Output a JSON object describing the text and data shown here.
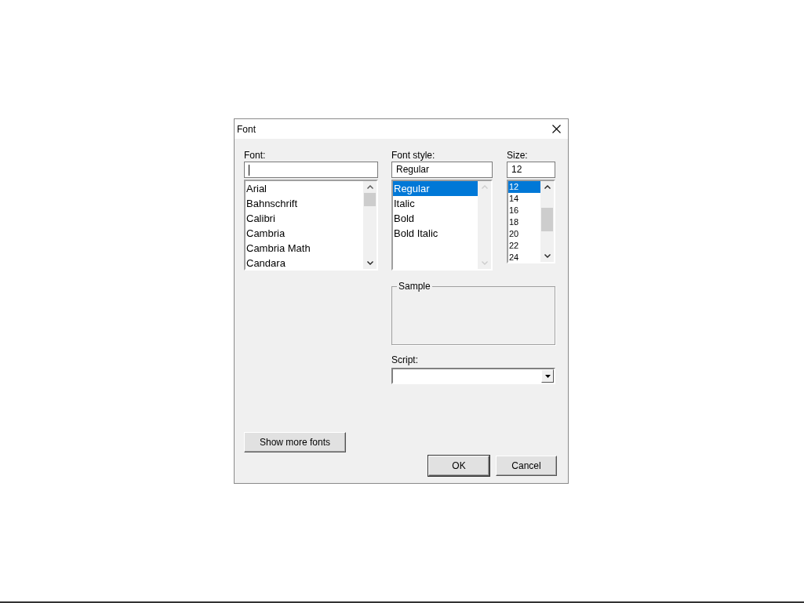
{
  "window": {
    "title": "Font"
  },
  "font": {
    "label": "Font:",
    "items": [
      {
        "label": "Arial",
        "selected": false
      },
      {
        "label": "Bahnschrift",
        "selected": false
      },
      {
        "label": "Calibri",
        "selected": false
      },
      {
        "label": "Cambria",
        "selected": false
      },
      {
        "label": "Cambria Math",
        "selected": false
      },
      {
        "label": "Candara",
        "selected": false
      }
    ]
  },
  "font_style": {
    "label": "Font style:",
    "value": "Regular",
    "items": [
      {
        "label": "Regular",
        "selected": true
      },
      {
        "label": "Italic",
        "selected": false
      },
      {
        "label": "Bold",
        "selected": false
      },
      {
        "label": "Bold Italic",
        "selected": false
      }
    ]
  },
  "size": {
    "label": "Size:",
    "value": "12",
    "items": [
      {
        "label": "12",
        "selected": true
      },
      {
        "label": "14",
        "selected": false
      },
      {
        "label": "16",
        "selected": false
      },
      {
        "label": "18",
        "selected": false
      },
      {
        "label": "20",
        "selected": false
      },
      {
        "label": "22",
        "selected": false
      },
      {
        "label": "24",
        "selected": false
      }
    ]
  },
  "sample": {
    "label": "Sample"
  },
  "script": {
    "label": "Script:"
  },
  "buttons": {
    "more_fonts": "Show more fonts",
    "ok": "OK",
    "cancel": "Cancel"
  }
}
